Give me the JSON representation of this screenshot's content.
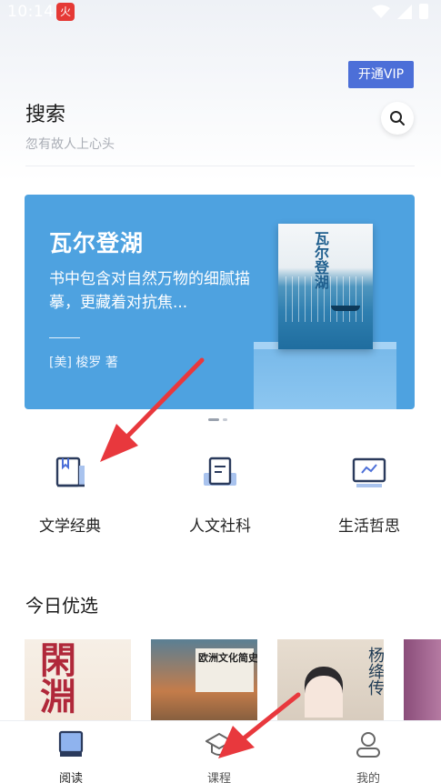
{
  "status_bar": {
    "time": "10:14",
    "app_badge": "火"
  },
  "header": {
    "vip_label": "开通VIP"
  },
  "search": {
    "title": "搜索",
    "placeholder": "忽有故人上心头"
  },
  "banner": {
    "book_title": "瓦尔登湖",
    "description": "书中包含对自然万物的细腻描摹，更藏着对抗焦...",
    "author": "[美] 梭罗 著",
    "cover_title": "瓦尔登湖"
  },
  "categories": [
    {
      "label": "文学经典",
      "icon": "book-bookmark-icon"
    },
    {
      "label": "人文社科",
      "icon": "open-book-icon"
    },
    {
      "label": "生活哲思",
      "icon": "monitor-trend-icon"
    }
  ],
  "today": {
    "title": "今日优选",
    "books": [
      {
        "cover_text": "閑淵"
      },
      {
        "cover_text": "欧洲文化简史"
      },
      {
        "cover_text": "杨绛传"
      },
      {
        "cover_text": ""
      }
    ]
  },
  "bottom_nav": [
    {
      "label": "阅读",
      "icon": "reading-icon",
      "active": true
    },
    {
      "label": "课程",
      "icon": "graduation-cap-icon",
      "active": false
    },
    {
      "label": "我的",
      "icon": "user-icon",
      "active": false
    }
  ],
  "colors": {
    "accent": "#4c6fd8",
    "banner": "#4ea2e0",
    "annotation": "#e8383d"
  }
}
